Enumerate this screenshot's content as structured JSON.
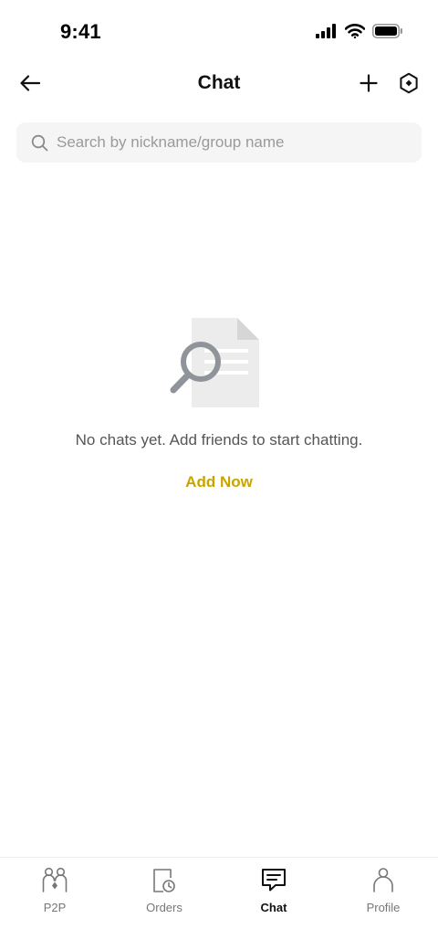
{
  "status_bar": {
    "time": "9:41"
  },
  "header": {
    "title": "Chat"
  },
  "search": {
    "placeholder": "Search by nickname/group name",
    "value": ""
  },
  "empty_state": {
    "message": "No chats yet. Add friends to start chatting.",
    "action_label": "Add Now"
  },
  "tab_bar": {
    "tabs": [
      {
        "label": "P2P",
        "icon": "p2p-icon",
        "active": false
      },
      {
        "label": "Orders",
        "icon": "orders-icon",
        "active": false
      },
      {
        "label": "Chat",
        "icon": "chat-icon",
        "active": true
      },
      {
        "label": "Profile",
        "icon": "profile-icon",
        "active": false
      }
    ]
  },
  "colors": {
    "accent": "#c9a400",
    "search_bg": "#f5f5f5",
    "inactive_tab": "#777777",
    "active_tab": "#111111"
  }
}
